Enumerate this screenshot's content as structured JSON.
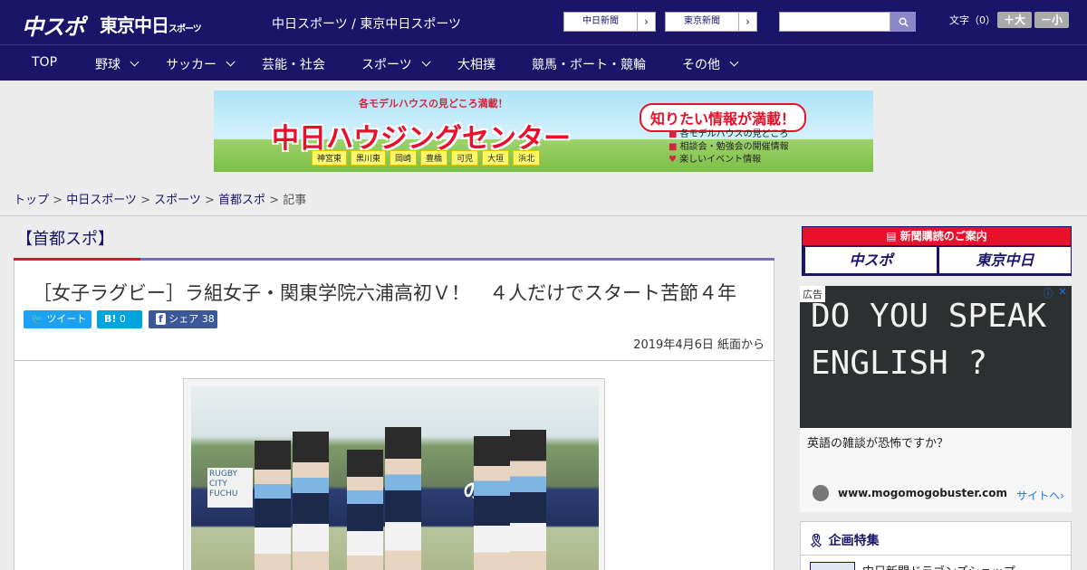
{
  "header": {
    "logo_chuspo": "中スポ",
    "logo_tokyo": "東京中日",
    "logo_tokyo_small": "スポーツ",
    "tagline": "中日スポーツ / 東京中日スポーツ",
    "newspaper_links": [
      "中日新聞",
      "東京新聞"
    ],
    "search_value": "",
    "font_size_label": "文字（0）",
    "font_bigger": "＋大",
    "font_smaller": "－小"
  },
  "nav": [
    {
      "label": "TOP",
      "dropdown": false
    },
    {
      "label": "野球",
      "dropdown": true
    },
    {
      "label": "サッカー",
      "dropdown": true
    },
    {
      "label": "芸能・社会",
      "dropdown": false
    },
    {
      "label": "スポーツ",
      "dropdown": true
    },
    {
      "label": "大相撲",
      "dropdown": false
    },
    {
      "label": "競馬・ボート・競輪",
      "dropdown": false
    },
    {
      "label": "その他",
      "dropdown": true
    }
  ],
  "banner": {
    "sub": "各モデルハウスの見どころ満載！",
    "main": "中日ハウジングセンター",
    "bubble": "知りたい情報が満載！",
    "cities": [
      "神宮東",
      "黒川東",
      "岡崎",
      "豊橋",
      "可児",
      "大垣",
      "浜北"
    ],
    "features": [
      "各モデルハウスの見どころ",
      "相談会・勉強会の開催情報",
      "楽しいイベント情報"
    ]
  },
  "breadcrumb": {
    "items": [
      "トップ",
      "中日スポーツ",
      "スポーツ",
      "首都スポ"
    ],
    "current": "記事",
    "sep": " > "
  },
  "section_label": "【首都スポ】",
  "article": {
    "title": "［女子ラグビー］ラ組女子・関東学院六浦高初Ｖ！　４人だけでスタート苦節４年",
    "share": {
      "tweet": "ツイート",
      "hatena": "0",
      "facebook_label": "シェア",
      "facebook_count": "38"
    },
    "date": "2019年4月6日 紙面から",
    "photo_sign": "RUGBY CITY FUCHU",
    "photo_banner": "のタ"
  },
  "sidebar": {
    "subscribe_header": "新聞購読のご案内",
    "subscribe_left": "中スポ",
    "subscribe_right": "東京中日",
    "ad_label": "広告",
    "ad_image_text_1": "DO YOU SPEAK",
    "ad_image_text_2": "ENGLISH ?",
    "ad_question": "英語の雑談が恐怖ですか？",
    "ad_url": "www.mogomogobuster.com",
    "ad_site_link": "サイトへ",
    "special_title": "企画特集",
    "special_item": "中日新聞ドラゴンズショップ"
  },
  "colors": {
    "brand_navy": "#1b1569",
    "accent_red": "#e8102b",
    "twitter": "#1da1f2",
    "hatena": "#00a4de",
    "facebook": "#3b5998"
  }
}
